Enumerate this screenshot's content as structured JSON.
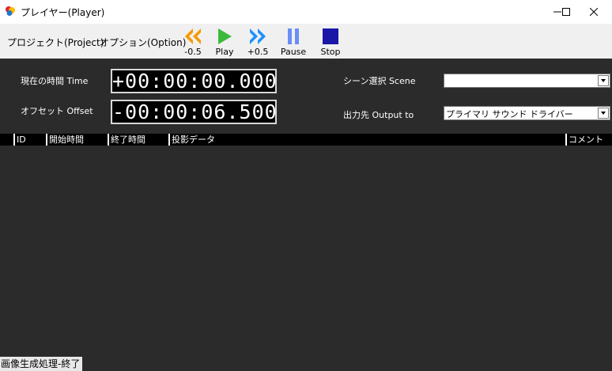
{
  "window": {
    "title": "プレイヤー(Player)"
  },
  "menu": {
    "project": "プロジェクト(Project)",
    "option": "オプション(Option)"
  },
  "controls": [
    {
      "label": "-0.5",
      "icon": "rewind-icon",
      "color": "#f59a00"
    },
    {
      "label": "Play",
      "icon": "play-icon",
      "color": "#3cb93c"
    },
    {
      "label": "+0.5",
      "icon": "fast-forward-icon",
      "color": "#1e90ff"
    },
    {
      "label": "Pause",
      "icon": "pause-icon",
      "color": "#6b8ef5"
    },
    {
      "label": "Stop",
      "icon": "stop-icon",
      "color": "#1a16a8"
    }
  ],
  "time": {
    "label": "現在の時間 Time",
    "value": "+00:00:00.000"
  },
  "offset": {
    "label": "オフセット  Offset",
    "value": "-00:00:06.500"
  },
  "scene": {
    "label": "シーン選択 Scene",
    "value": ""
  },
  "output": {
    "label": "出力先   Output to",
    "value": "プライマリ サウンド ドライバー"
  },
  "table": {
    "columns": [
      "ID",
      "開始時間",
      "終了時間",
      "投影データ",
      "コメント"
    ],
    "rows": []
  },
  "status": {
    "text": "画像生成処理-終了"
  }
}
